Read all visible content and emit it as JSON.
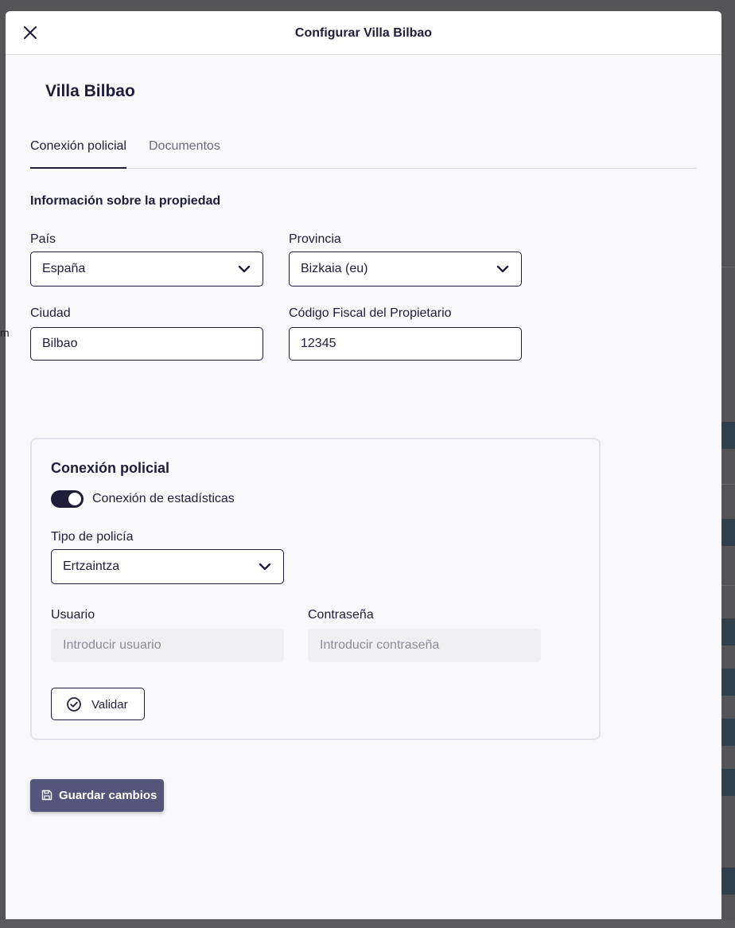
{
  "modal": {
    "title": "Configurar Villa Bilbao",
    "close_icon": "close-icon"
  },
  "property": {
    "name": "Villa Bilbao"
  },
  "tabs": [
    {
      "label": "Conexión policial",
      "active": true
    },
    {
      "label": "Documentos",
      "active": false
    }
  ],
  "info_section": {
    "title": "Información sobre la propiedad",
    "country": {
      "label": "País",
      "value": "España"
    },
    "province": {
      "label": "Provincia",
      "value": "Bizkaia (eu)"
    },
    "city": {
      "label": "Ciudad",
      "value": "Bilbao"
    },
    "tax_code": {
      "label": "Código Fiscal del Propietario",
      "value": "12345"
    }
  },
  "police_section": {
    "title": "Conexión policial",
    "toggle": {
      "label": "Conexión de estadísticas",
      "on": true
    },
    "police_type": {
      "label": "Tipo de policía",
      "value": "Ertzaintza"
    },
    "user": {
      "label": "Usuario",
      "placeholder": "Introducir usuario"
    },
    "password": {
      "label": "Contraseña",
      "placeholder": "Introducir contraseña"
    },
    "validate_label": "Validar",
    "validate_icon": "check-circle-icon"
  },
  "save": {
    "label": "Guardar cambios",
    "icon": "floppy-disk-icon"
  },
  "colors": {
    "primary": "#1f1d3a",
    "save_button": "#55547a",
    "modal_bg": "#f9f9fc"
  }
}
